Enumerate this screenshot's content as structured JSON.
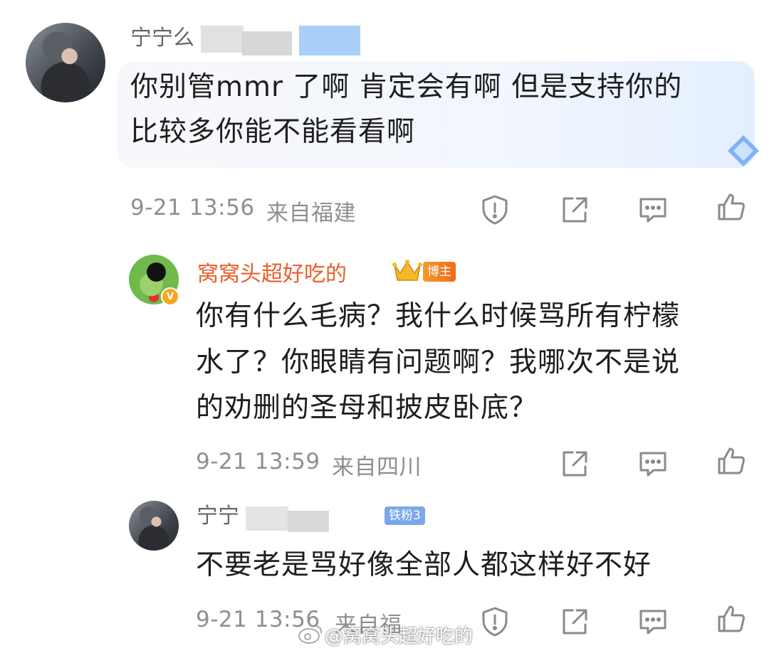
{
  "comments": [
    {
      "user": "宁宁么",
      "text_line1": "你别管mmr 了啊 肯定会有啊 但是支持你的",
      "text_line2": "比较多你能不能看看啊",
      "time": "9-21 13:56",
      "location": "来自福建"
    },
    {
      "user": "窝窝头超好吃的",
      "host_tag": "博主",
      "v_badge": "V",
      "text_line1": "你有什么毛病？我什么时候骂所有柠檬",
      "text_line2": "水了？你眼睛有问题啊？我哪次不是说",
      "text_line3": "的劝删的圣母和披皮卧底？",
      "time": "9-21 13:59",
      "location": "来自四川"
    },
    {
      "user": "宁宁",
      "fan_tag": "铁粉3",
      "text_line1": "不要老是骂好像全部人都这样好不好",
      "time": "9-21 13:56",
      "location": "来自福"
    }
  ],
  "watermark": "@窝窝头超好吃的",
  "icons": [
    "report-icon",
    "share-icon",
    "comment-icon",
    "like-icon"
  ],
  "colors": {
    "username": "#e8602c",
    "meta": "#8f8f8f",
    "icon": "#8a8a8a"
  }
}
